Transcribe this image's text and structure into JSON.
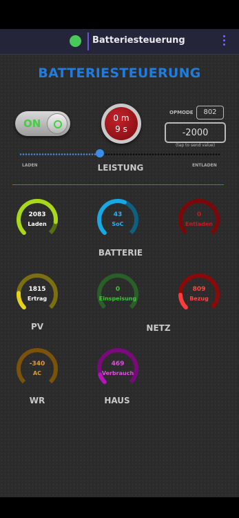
{
  "app": {
    "title": "Batteriesteuerung"
  },
  "main": {
    "title": "BATTERIESTEUERUNG"
  },
  "toggle": {
    "label": "ON"
  },
  "timer": {
    "minutes": "0 m",
    "seconds": "9 s"
  },
  "opmode": {
    "label": "OPMODE",
    "value": "802"
  },
  "power_input": {
    "value": "-2000",
    "hint": "(tap to send value)"
  },
  "slider": {
    "left_label": "LADEN",
    "center_label": "LEISTUNG",
    "right_label": "ENTLADEN",
    "fraction": 0.4
  },
  "sections": {
    "batterie": "BATTERIE",
    "pv": "PV",
    "netz": "NETZ",
    "wr": "WR",
    "haus": "HAUS"
  },
  "gauges": {
    "laden": {
      "value": "2083",
      "label": "Laden",
      "color": "#a8d81a",
      "track": "#55700e",
      "fraction": 0.86,
      "text_color": "#ffffff"
    },
    "soc": {
      "value": "43",
      "label": "SoC",
      "color": "#18a8e4",
      "track": "#0f5f80",
      "fraction": 0.58,
      "text_color": "#2fb0ee"
    },
    "entladen": {
      "value": "0",
      "label": "Entladen",
      "color": "#b80d12",
      "track": "#7a0808",
      "fraction": 0.0,
      "text_color": "#cc1a1a"
    },
    "ertrag": {
      "value": "1815",
      "label": "Ertrag",
      "color": "#e6d21a",
      "track": "#7a7010",
      "fraction": 0.18,
      "text_color": "#ffffff"
    },
    "einspeisung": {
      "value": "0",
      "label": "Einspeisung",
      "color": "#2f7f2c",
      "track": "#2a6027",
      "fraction": 0.0,
      "text_color": "#3dc43a"
    },
    "bezug": {
      "value": "809",
      "label": "Bezug",
      "color": "#ff3b3b",
      "track": "#8a0a0a",
      "fraction": 0.16,
      "text_color": "#ff4444"
    },
    "ac": {
      "value": "-340",
      "label": "AC",
      "color": "#b3770e",
      "track": "#7a520a",
      "fraction": 0.0,
      "text_color": "#e19b2c"
    },
    "verbrauch": {
      "value": "469",
      "label": "Verbrauch",
      "color": "#b514b8",
      "track": "#7a0a7c",
      "fraction": 0.1,
      "text_color": "#e04ce3"
    }
  }
}
